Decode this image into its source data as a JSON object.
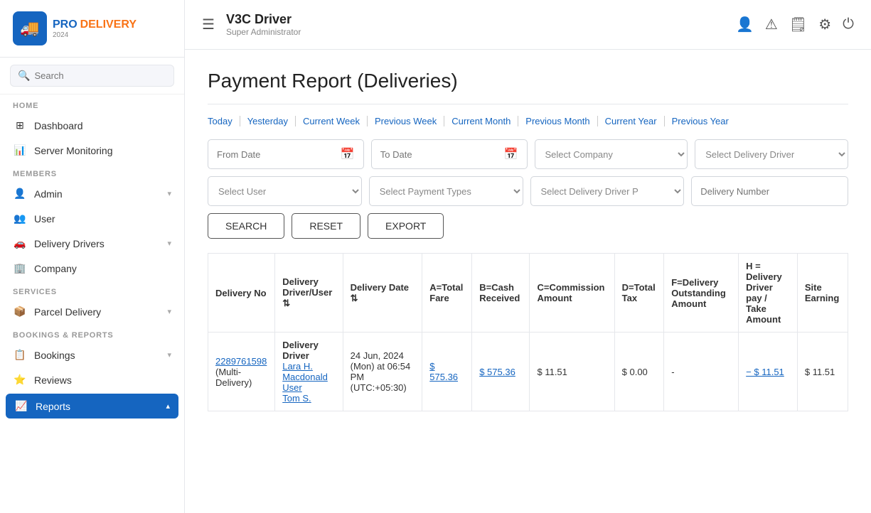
{
  "sidebar": {
    "logo": {
      "pro": "PRO",
      "pro_highlight": " ",
      "delivery": "DELIVERY",
      "year": "2024"
    },
    "search_placeholder": "Search",
    "sections": [
      {
        "label": "HOME",
        "items": [
          {
            "id": "dashboard",
            "label": "Dashboard",
            "icon": "⊞",
            "has_arrow": false
          },
          {
            "id": "server-monitoring",
            "label": "Server Monitoring",
            "icon": "📊",
            "has_arrow": false
          }
        ]
      },
      {
        "label": "MEMBERS",
        "items": [
          {
            "id": "admin",
            "label": "Admin",
            "icon": "👤",
            "has_arrow": true
          },
          {
            "id": "user",
            "label": "User",
            "icon": "👥",
            "has_arrow": false
          },
          {
            "id": "delivery-drivers",
            "label": "Delivery Drivers",
            "icon": "🚗",
            "has_arrow": true
          },
          {
            "id": "company",
            "label": "Company",
            "icon": "🏢",
            "has_arrow": false
          }
        ]
      },
      {
        "label": "SERVICES",
        "items": [
          {
            "id": "parcel-delivery",
            "label": "Parcel Delivery",
            "icon": "📦",
            "has_arrow": true
          }
        ]
      },
      {
        "label": "BOOKINGS & REPORTS",
        "items": [
          {
            "id": "bookings",
            "label": "Bookings",
            "icon": "📋",
            "has_arrow": true
          },
          {
            "id": "reviews",
            "label": "Reviews",
            "icon": "⭐",
            "has_arrow": false
          },
          {
            "id": "reports",
            "label": "Reports",
            "icon": "📈",
            "has_arrow": true,
            "active": true
          }
        ]
      }
    ]
  },
  "topbar": {
    "menu_label": "☰",
    "title": "V3C Driver",
    "role": "Super Administrator",
    "icons": [
      "👤",
      "⚠",
      "📄",
      "⚙",
      "⏻"
    ]
  },
  "page": {
    "title": "Payment Report (Deliveries)",
    "date_tabs": [
      "Today",
      "Yesterday",
      "Current Week",
      "Previous Week",
      "Current Month",
      "Previous Month",
      "Current Year",
      "Previous Year"
    ],
    "filters": {
      "from_date_placeholder": "From Date",
      "to_date_placeholder": "To Date",
      "select_company": "Select Company",
      "select_delivery_driver_top": "Select Delivery Driver",
      "select_user": "Select User",
      "select_payment_types": "Select Payment Types",
      "select_delivery_driver_status": "Select Delivery Driver P",
      "delivery_number_placeholder": "Delivery Number"
    },
    "buttons": {
      "search": "SEARCH",
      "reset": "RESET",
      "export": "EXPORT"
    },
    "table": {
      "headers": [
        "Delivery No",
        "Delivery Driver/User",
        "Delivery Date",
        "A=Total Fare",
        "B=Cash Received",
        "C=Commission Amount",
        "D=Total Tax",
        "F=Delivery Outstanding Amount",
        "H = Delivery Driver pay / Take Amount",
        "Site Earning"
      ],
      "rows": [
        {
          "delivery_no": "2289761598",
          "delivery_no_note": "(Multi-Delivery)",
          "driver": "Delivery Driver",
          "user_link": "Lara H. Macdonald User",
          "user_link2": "Tom S.",
          "delivery_date": "24 Jun, 2024 (Mon) at 06:54 PM (UTC:+05:30)",
          "total_fare": "$ 575.36",
          "cash_received": "$ 575.36",
          "commission": "$ 11.51",
          "total_tax": "$ 0.00",
          "outstanding": "-",
          "take_amount": "− $ 11.51",
          "site_earning": "$ 11.51"
        }
      ]
    }
  }
}
